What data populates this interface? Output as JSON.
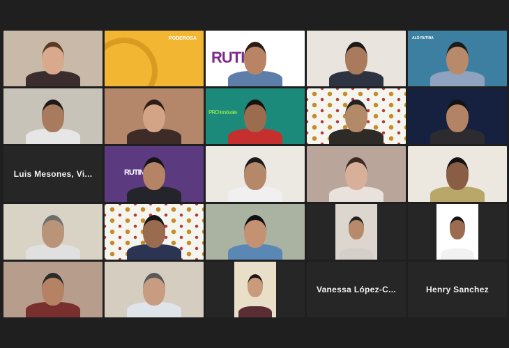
{
  "participants": [
    {
      "id": "p1",
      "type": "video",
      "bg": "#c9b9a8",
      "skin": "#d8a98c",
      "shirt": "#3b2d2d",
      "hair": "#5a3a22"
    },
    {
      "id": "p2",
      "type": "banner",
      "bg": "#f2b632",
      "text": "PODEROSA"
    },
    {
      "id": "p3",
      "type": "video",
      "bg": "#ffffff",
      "skin": "#b98465",
      "shirt": "#5d7ea8",
      "hair": "#2a1d18",
      "logo": "RUTINA"
    },
    {
      "id": "p4",
      "type": "video",
      "bg": "#e9e5de",
      "skin": "#a97a5c",
      "shirt": "#2d3340",
      "hair": "#1c1a1a"
    },
    {
      "id": "p5",
      "type": "video",
      "bg": "#3d7fa0",
      "skin": "#b88a6b",
      "shirt": "#8fa3c0",
      "hair": "#1b1b1b",
      "banner_text": "ALÓ RUTINA"
    },
    {
      "id": "p6",
      "type": "video",
      "bg": "#c8c3b8",
      "skin": "#a87a5e",
      "shirt": "#e6e6e6",
      "hair": "#1f1a18",
      "active": true
    },
    {
      "id": "p7",
      "type": "video",
      "bg": "#b4866a",
      "skin": "#d4a487",
      "shirt": "#3c2b27",
      "hair": "#2c1d16"
    },
    {
      "id": "p8",
      "type": "video",
      "bg": "#1c8a7a",
      "skin": "#9c6c4e",
      "shirt": "#c5302e",
      "hair": "#161212",
      "logo": "PRO innóvate"
    },
    {
      "id": "p9",
      "type": "video",
      "bg": "pattern",
      "skin": "#b38a68",
      "shirt": "#2e2a26",
      "hair": "#222"
    },
    {
      "id": "p10",
      "type": "video",
      "bg": "#16213f",
      "skin": "#b28365",
      "shirt": "#2b2b30",
      "hair": "#121212"
    },
    {
      "id": "p11",
      "type": "name",
      "name": "Luis Mesones, Vi..."
    },
    {
      "id": "p12",
      "type": "video",
      "bg": "#5b3a80",
      "skin": "#b58466",
      "shirt": "#24252b",
      "hair": "#141414",
      "logo": "RUTINA"
    },
    {
      "id": "p13",
      "type": "video",
      "bg": "#ece8e2",
      "skin": "#b48868",
      "shirt": "#f0f0f0",
      "hair": "#1a1a1a"
    },
    {
      "id": "p14",
      "type": "video",
      "bg": "#b9a59a",
      "skin": "#d8b09a",
      "shirt": "#e8e1dc",
      "hair": "#3a2a22"
    },
    {
      "id": "p15",
      "type": "video",
      "bg": "#ece8e0",
      "skin": "#8a5e45",
      "shirt": "#b9a76a",
      "hair": "#121212"
    },
    {
      "id": "p16",
      "type": "video",
      "bg": "#d8d3c4",
      "skin": "#b99478",
      "shirt": "#e0e0e0",
      "hair": "#6d6d6d"
    },
    {
      "id": "p17",
      "type": "video",
      "bg": "pattern",
      "skin": "#9a6b4f",
      "shirt": "#2b3553",
      "hair": "#151515"
    },
    {
      "id": "p18",
      "type": "video",
      "bg": "#aab3a2",
      "skin": "#c49273",
      "shirt": "#5b87b4",
      "hair": "#101010"
    },
    {
      "id": "p19",
      "type": "video-small",
      "bg": "#dcd6cf",
      "skin": "#b78a6b",
      "shirt": "#d4cfc9",
      "hair": "#222"
    },
    {
      "id": "p20",
      "type": "video-small",
      "bg": "#ffffff",
      "skin": "#9c6c50",
      "shirt": "#f2f2f2",
      "hair": "#141414"
    },
    {
      "id": "p21",
      "type": "video",
      "bg": "#b69d8c",
      "skin": "#b58363",
      "shirt": "#7a2f2f",
      "hair": "#2b2b2b"
    },
    {
      "id": "p22",
      "type": "video",
      "bg": "#d4cdc0",
      "skin": "#c79c80",
      "shirt": "#dfe3ea",
      "hair": "#5a5a5a"
    },
    {
      "id": "p23",
      "type": "video-small",
      "bg": "#e9dfc9",
      "skin": "#c99a7c",
      "shirt": "#5a2c33",
      "hair": "#1a1414"
    },
    {
      "id": "p24",
      "type": "name",
      "name": "Vanessa  López-C..."
    },
    {
      "id": "p25",
      "type": "name",
      "name": "Henry Sanchez"
    }
  ]
}
